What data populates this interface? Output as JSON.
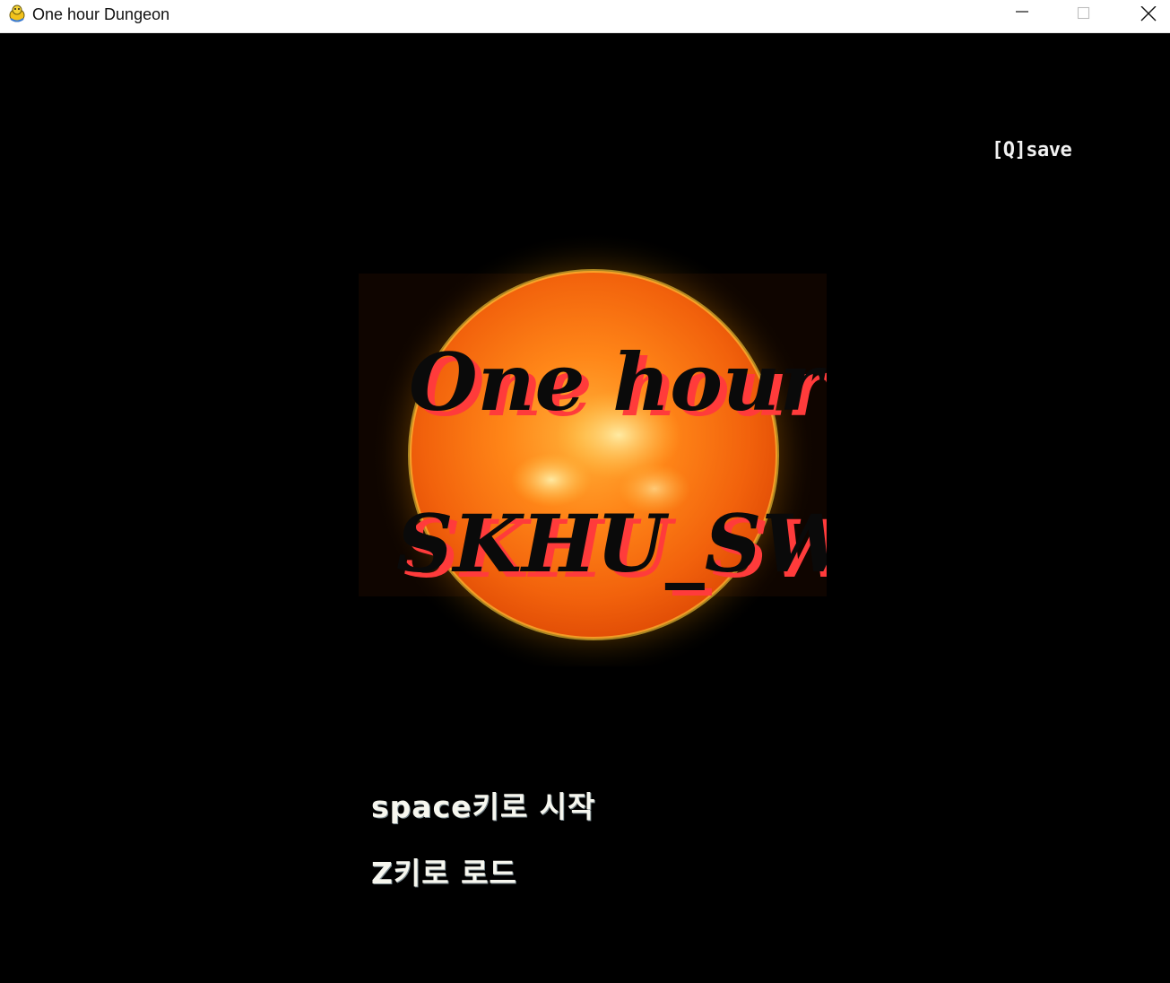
{
  "window": {
    "title": "One hour Dungeon",
    "app_icon": "pygame-snake-icon",
    "controls": [
      "minimize-icon",
      "maximize-icon",
      "close-icon"
    ]
  },
  "game": {
    "save_hint": "[Q]save",
    "logo": {
      "line1": "One hour",
      "line2": "SKHU_SW",
      "background": "sun-image"
    },
    "menu": {
      "start": "space키로 시작",
      "load": "Z키로 로드"
    }
  },
  "colors": {
    "background": "#000000",
    "titlebar": "#ffffff",
    "logo_text": "#0a0a0a",
    "logo_shadow": "#ff3b3b",
    "sun_core": "#ff7a12",
    "menu_text": "#f7f7ef"
  }
}
